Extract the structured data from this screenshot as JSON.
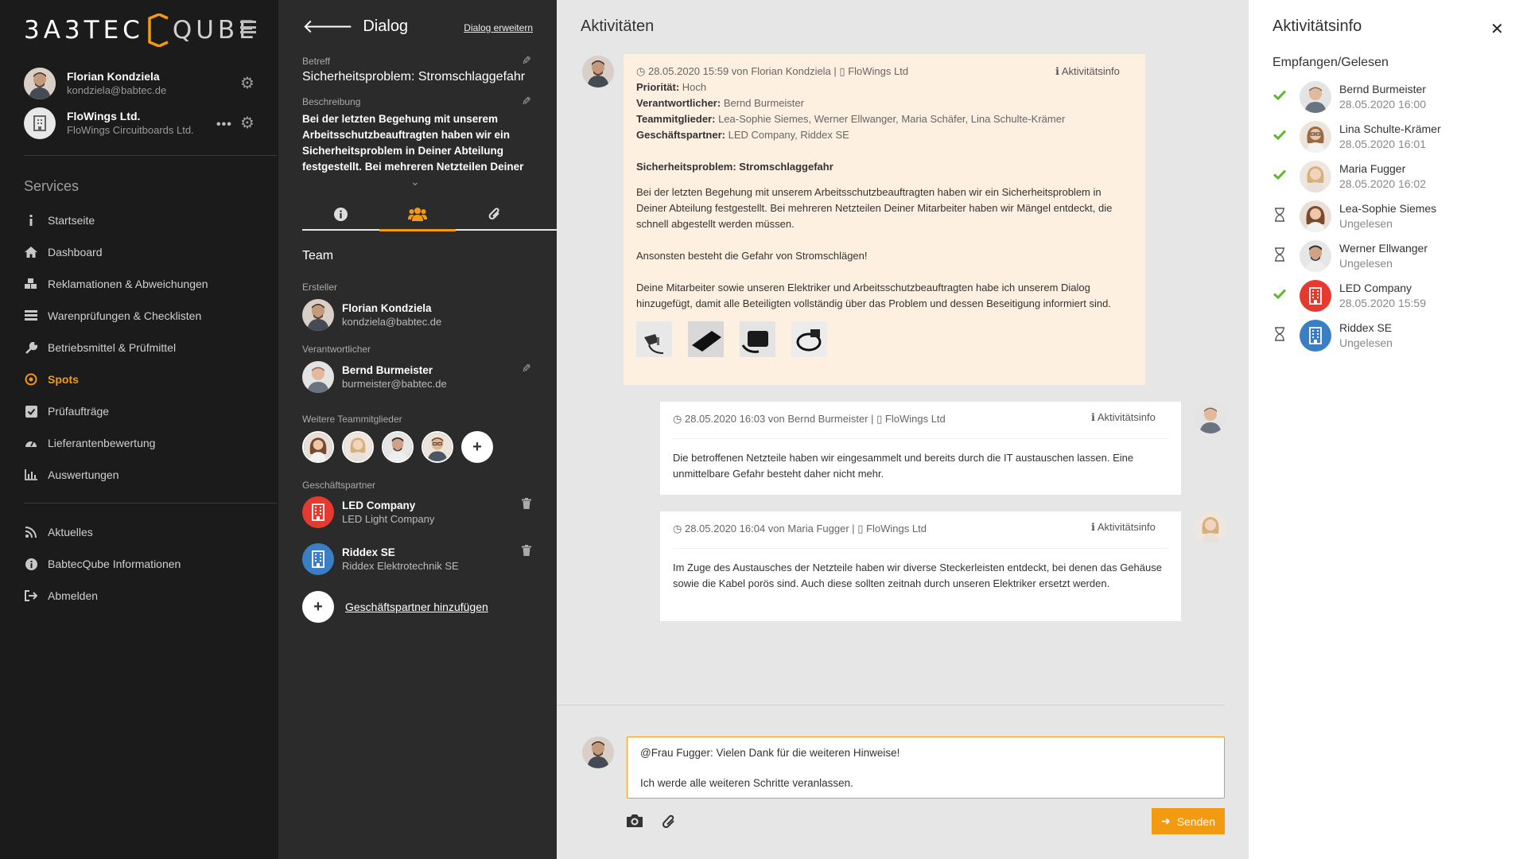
{
  "sidebar": {
    "logo_a": "3A3TEC",
    "logo_b": "QUBE",
    "user": {
      "name": "Florian Kondziela",
      "email": "kondziela@babtec.de"
    },
    "company": {
      "name": "FloWings Ltd.",
      "sub": "FloWings Circuitboards Ltd."
    },
    "services_label": "Services",
    "items": [
      {
        "label": "Startseite",
        "icon": "info-icon"
      },
      {
        "label": "Dashboard",
        "icon": "home-icon"
      },
      {
        "label": "Reklamationen & Abweichungen",
        "icon": "cubes-icon"
      },
      {
        "label": "Warenprüfungen & Checklisten",
        "icon": "list-icon"
      },
      {
        "label": "Betriebsmittel & Prüfmittel",
        "icon": "wrench-icon"
      },
      {
        "label": "Spots",
        "icon": "target-icon"
      },
      {
        "label": "Prüfaufträge",
        "icon": "check-square-icon"
      },
      {
        "label": "Lieferantenbewertung",
        "icon": "gauge-icon"
      },
      {
        "label": "Auswertungen",
        "icon": "bar-chart-icon"
      }
    ],
    "bottom_items": [
      {
        "label": "Aktuelles",
        "icon": "rss-icon"
      },
      {
        "label": "BabtecQube Informationen",
        "icon": "info-circle-icon"
      },
      {
        "label": "Abmelden",
        "icon": "logout-icon"
      }
    ]
  },
  "dialog": {
    "title": "Dialog",
    "extend": "Dialog erweitern",
    "subject_label": "Betreff",
    "subject": "Sicherheitsproblem: Stromschlaggefahr",
    "desc_label": "Beschreibung",
    "description": "Bei der letzten Begehung mit unserem Arbeitsschutzbeauftragten haben wir ein Sicherheitsproblem in Deiner Abteilung festgestellt. Bei mehreren Netzteilen Deiner",
    "team_title": "Team",
    "creator_label": "Ersteller",
    "creator": {
      "name": "Florian Kondziela",
      "email": "kondziela@babtec.de"
    },
    "resp_label": "Verantwortlicher",
    "resp": {
      "name": "Bernd Burmeister",
      "email": "burmeister@babtec.de"
    },
    "members_label": "Weitere Teammitglieder",
    "partners_label": "Geschäftspartner",
    "partners": [
      {
        "name": "LED Company",
        "sub": "LED Light Company"
      },
      {
        "name": "Riddex SE",
        "sub": "Riddex Elektrotechnik SE"
      }
    ],
    "add_partner": "Geschäftspartner hinzufügen"
  },
  "activities": {
    "title": "Aktivitäten",
    "info_link": "Aktivitätsinfo",
    "first": {
      "meta": "28.05.2020 15:59 von Florian Kondziela | ",
      "meta_company": "FloWings Ltd",
      "prio_label": "Priorität:",
      "prio": "Hoch",
      "resp_label": "Verantwortlicher:",
      "resp": "Bernd Burmeister",
      "team_label": "Teammitglieder:",
      "team": "Lea-Sophie Siemes, Werner Ellwanger, Maria Schäfer, Lina Schulte-Krämer",
      "partner_label": "Geschäftspartner:",
      "partner": "LED Company, Riddex SE",
      "heading": "Sicherheitsproblem: Stromschlaggefahr",
      "p1": "Bei der letzten Begehung mit unserem Arbeitsschutzbeauftragten haben wir ein Sicherheitsproblem in Deiner Abteilung festgestellt. Bei mehreren Netzteilen Deiner Mitarbeiter haben wir Mängel entdeckt, die schnell abgestellt werden müssen.",
      "p2": "Ansonsten besteht die Gefahr von Stromschlägen!",
      "p3": "Deine Mitarbeiter sowie unseren Elektriker und Arbeitsschutzbeauftragten habe ich unserem Dialog hinzugefügt, damit alle Beteiligten vollständig über das Problem und dessen Beseitigung informiert sind."
    },
    "second": {
      "meta": "28.05.2020 16:03 von Bernd Burmeister | ",
      "meta_company": "FloWings Ltd",
      "text": "Die betroffenen Netzteile haben wir eingesammelt und bereits durch die IT austauschen lassen. Eine unmittelbare Gefahr besteht daher nicht mehr."
    },
    "third": {
      "meta": "28.05.2020 16:04 von Maria Fugger | ",
      "meta_company": "FloWings Ltd",
      "text": "Im Zuge des Austausches der Netzteile haben wir diverse Steckerleisten entdeckt, bei denen das Gehäuse sowie die Kabel porös sind. Auch diese sollten zeitnah durch unseren Elektriker ersetzt werden."
    },
    "reply_line1": "@Frau Fugger: Vielen Dank für die weiteren Hinweise!",
    "reply_line2": "Ich werde alle weiteren Schritte veranlassen.",
    "send": "Senden"
  },
  "info_panel": {
    "title": "Aktivitätsinfo",
    "subtitle": "Empfangen/Gelesen",
    "recipients": [
      {
        "name": "Bernd Burmeister",
        "date": "28.05.2020 16:00",
        "status": "read"
      },
      {
        "name": "Lina Schulte-Krämer",
        "date": "28.05.2020 16:01",
        "status": "read"
      },
      {
        "name": "Maria Fugger",
        "date": "28.05.2020 16:02",
        "status": "read"
      },
      {
        "name": "Lea-Sophie Siemes",
        "date": "Ungelesen",
        "status": "unread"
      },
      {
        "name": "Werner Ellwanger",
        "date": "Ungelesen",
        "status": "unread"
      },
      {
        "name": "LED Company",
        "date": "28.05.2020 15:59",
        "status": "read"
      },
      {
        "name": "Riddex SE",
        "date": "Ungelesen",
        "status": "unread"
      }
    ]
  },
  "colors": {
    "accent": "#f29a12",
    "read": "#5cb82e",
    "led": "#e53a2f",
    "riddex": "#3a7fc4"
  }
}
